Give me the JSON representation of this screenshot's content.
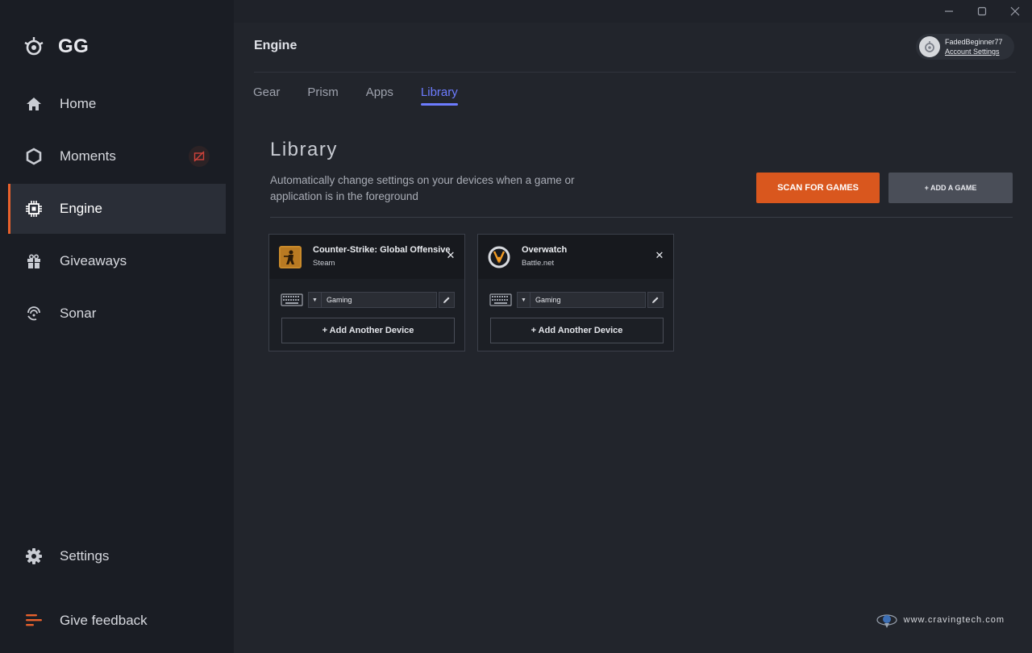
{
  "app": {
    "name": "GG"
  },
  "sidebar": {
    "items": [
      {
        "label": "Home",
        "icon": "home-icon"
      },
      {
        "label": "Moments",
        "icon": "hexagon-icon"
      },
      {
        "label": "Engine",
        "icon": "chip-icon"
      },
      {
        "label": "Giveaways",
        "icon": "gift-icon"
      },
      {
        "label": "Sonar",
        "icon": "sonar-icon"
      }
    ],
    "bottom": [
      {
        "label": "Settings",
        "icon": "gear-icon"
      },
      {
        "label": "Give feedback",
        "icon": "feedback-icon"
      }
    ],
    "active": "Engine",
    "accent": "#e8612c"
  },
  "header": {
    "title": "Engine",
    "account": {
      "username": "FadedBeginner77",
      "link": "Account Settings"
    }
  },
  "tabs": [
    {
      "label": "Gear"
    },
    {
      "label": "Prism"
    },
    {
      "label": "Apps"
    },
    {
      "label": "Library"
    }
  ],
  "library": {
    "title": "Library",
    "description": "Automatically change settings on your devices when a game or application is in the foreground",
    "scan_label": "SCAN FOR GAMES",
    "add_label": "+ ADD A GAME",
    "games": [
      {
        "name": "Counter-Strike: Global Offensive",
        "platform": "Steam",
        "profile": "Gaming",
        "add_device": "+ Add Another Device"
      },
      {
        "name": "Overwatch",
        "platform": "Battle.net",
        "profile": "Gaming",
        "add_device": "+ Add Another Device"
      }
    ]
  },
  "watermark": "www.cravingtech.com"
}
